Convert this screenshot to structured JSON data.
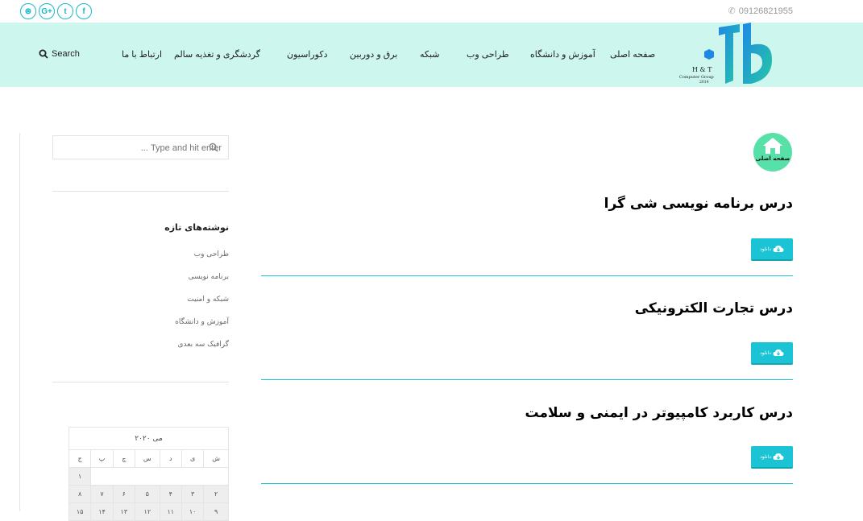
{
  "topbar": {
    "social_icons": [
      {
        "name": "dribbble-icon",
        "glyph": "⊛"
      },
      {
        "name": "google-plus-icon",
        "glyph": "G+"
      },
      {
        "name": "twitter-icon",
        "glyph": "t"
      },
      {
        "name": "facebook-icon",
        "glyph": "f"
      }
    ],
    "phone": "09126821955"
  },
  "header": {
    "logo": {
      "letters": "H & T",
      "line2": "Computer Group",
      "line3": "2014"
    },
    "nav": [
      {
        "label": "صفحه اصلی"
      },
      {
        "label": "آموزش و دانشگاه"
      },
      {
        "label": "طراحی وب"
      },
      {
        "label": "شبکه"
      },
      {
        "label": "برق و دوربین"
      },
      {
        "label": "دکوراسیون"
      },
      {
        "label": "گردشگری و تغذیه سالم"
      },
      {
        "label": "ارتباط با ما"
      }
    ],
    "search_label": "Search"
  },
  "sidebar": {
    "search_placeholder": "Type and hit enter ...",
    "recent_title": "نوشته‌های تازه",
    "recent_posts": [
      "طراحی وب",
      "برنامه نویسی",
      "شبکه و امنیت",
      "آموزش و دانشگاه",
      "گرافیک سه بعدی"
    ],
    "calendar": {
      "caption": "می ۲۰۲۰",
      "weekdays": [
        "ش",
        "ی",
        "د",
        "س",
        "چ",
        "پ",
        "ج"
      ],
      "rows": [
        [
          "",
          "",
          "",
          "",
          "",
          "",
          "۱"
        ],
        [
          "۲",
          "۳",
          "۴",
          "۵",
          "۶",
          "۷",
          "۸"
        ],
        [
          "۹",
          "۱۰",
          "۱۱",
          "۱۲",
          "۱۳",
          "۱۴",
          "۱۵"
        ]
      ]
    }
  },
  "main": {
    "home_badge_label": "صفحه اصلی",
    "posts": [
      {
        "title": "درس برنامه نویسی شی گرا",
        "download_label": "دانلود"
      },
      {
        "title": "درس تجارت الکترونیکی",
        "download_label": "دانلود"
      },
      {
        "title": "درس کاربرد کامپیوتر در ایمنی و سلامت",
        "download_label": "دانلود"
      }
    ]
  },
  "colors": {
    "accent": "#1bc4d5",
    "header_bg": "#ccf6ee",
    "home_badge": "#57e0a8"
  }
}
